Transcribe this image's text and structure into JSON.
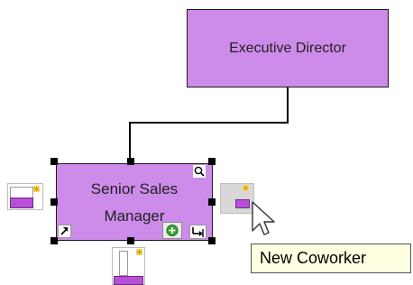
{
  "diagram": {
    "executive_box": {
      "label": "Executive Director"
    },
    "selected_box": {
      "line1": "Senior Sales",
      "line2": "Manager"
    }
  },
  "tooltip": {
    "text": "New Coworker"
  },
  "icons": {
    "magnifier": "magnifier-icon",
    "resize_arrow": "resize-arrow-icon",
    "add_subordinate": "add-subordinate-icon",
    "add_coworker": "add-coworker-icon",
    "add_peer_left": "add-peer-left-icon",
    "connector": "connector-icon",
    "expand": "expand-icon"
  },
  "colors": {
    "box_fill": "#cd8bea",
    "tooltip_bg": "#ffffe1",
    "mini_fill": "#b84fd6"
  }
}
